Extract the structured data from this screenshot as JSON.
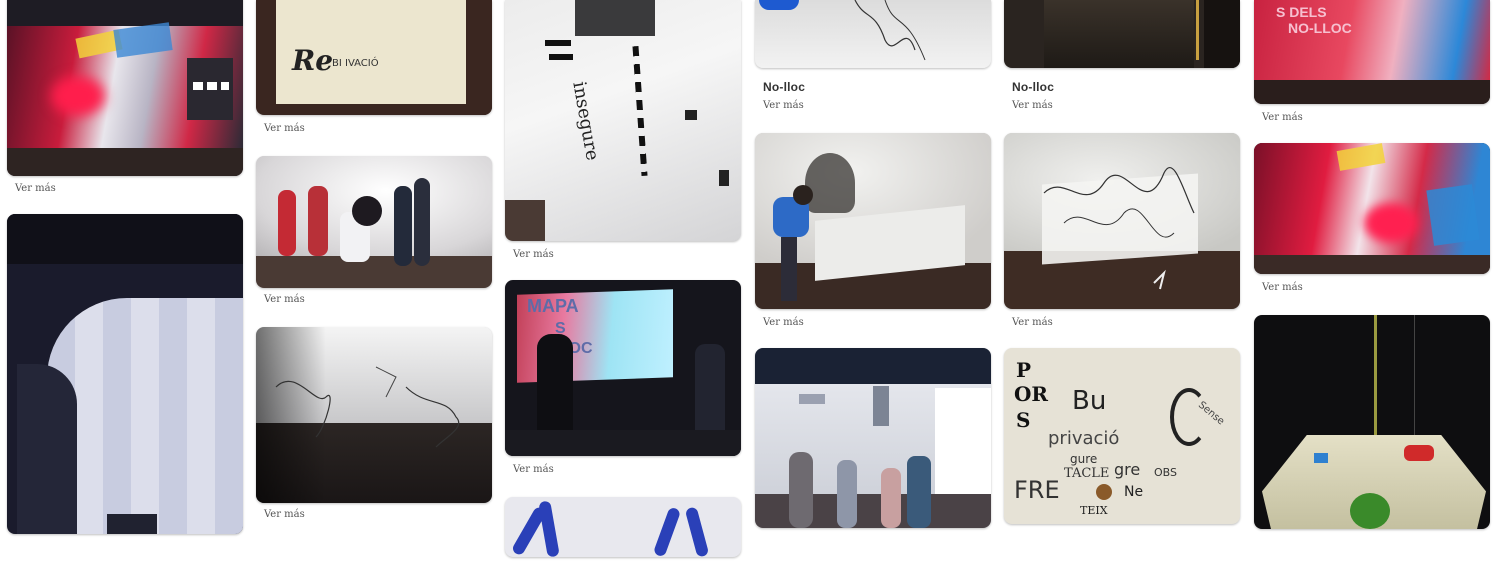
{
  "pins": {
    "c1p1": {
      "more": "Ver más"
    },
    "c1p2": {
      "more": ""
    },
    "c2p1": {
      "more": "Ver más",
      "text": {
        "big": "Re",
        "small": "BI IVACIÓ"
      }
    },
    "c2p2": {
      "more": "Ver más"
    },
    "c2p3": {
      "more": "Ver más"
    },
    "c3p1": {
      "more": "Ver más",
      "text": {
        "vertical": "insegure"
      }
    },
    "c3p2": {
      "more": "Ver más",
      "text": {
        "line1": "MAPA",
        "line2": "S",
        "line3": "LLOC"
      }
    },
    "c3p3": {
      "more": ""
    },
    "c4p1": {
      "title": "No-lloc",
      "more": "Ver más"
    },
    "c4p2": {
      "more": "Ver más"
    },
    "c4p3": {
      "more": ""
    },
    "c5p1": {
      "title": "No-lloc",
      "more": "Ver más"
    },
    "c5p2": {
      "more": "Ver más"
    },
    "c5p3": {
      "more": "",
      "text": {
        "w1": "P",
        "w2": "OR",
        "w3": "S",
        "w4": "Bu",
        "w5": "privació",
        "w6": "gure",
        "w7": "TACLE",
        "w8": "gre",
        "w9": "FRE",
        "w10": "Ne",
        "w11": "TEIX",
        "w12": "OBS",
        "w13": "Sense"
      }
    },
    "c6p1": {
      "more": "Ver más",
      "text": {
        "line1": "S DELS",
        "line2": "NO-LLOC"
      }
    },
    "c6p2": {
      "more": "Ver más"
    },
    "c6p3": {
      "more": ""
    }
  },
  "colors": {
    "accent_red": "#e0203a",
    "accent_blue": "#2f7fc8",
    "dark_floor": "#3a2a22"
  }
}
